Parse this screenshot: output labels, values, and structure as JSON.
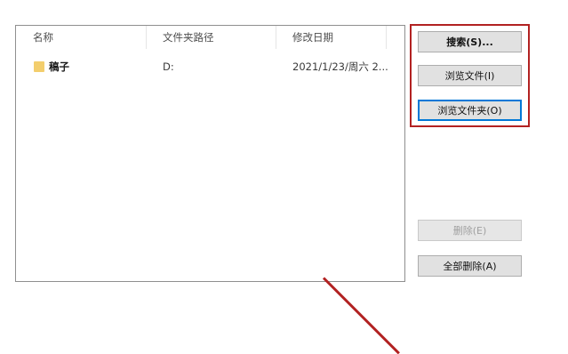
{
  "list": {
    "columns": [
      "名称",
      "文件夹路径",
      "修改日期"
    ],
    "rows": [
      {
        "name": "稿子",
        "path": "D:",
        "date": "2021/1/23/周六 2..."
      }
    ]
  },
  "buttons": {
    "search": "搜索(S)...",
    "browse_file": "浏览文件(I)",
    "browse_folder": "浏览文件夹(O)",
    "delete": "删除(E)",
    "delete_all": "全部删除(A)"
  },
  "colors": {
    "highlight": "#b22222",
    "focus": "#0078d7",
    "folder": "#f3ce6d"
  }
}
